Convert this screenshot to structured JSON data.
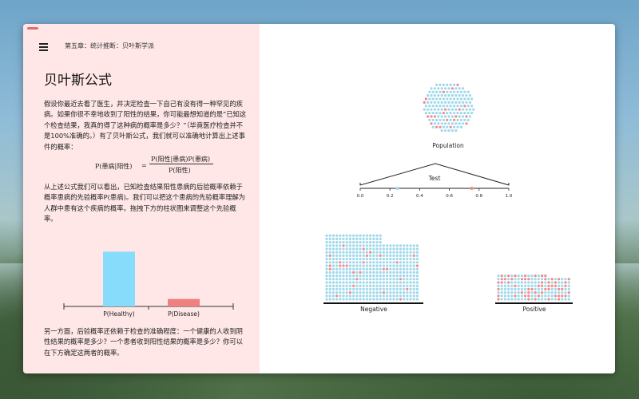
{
  "breadcrumb": "第五章：统计推断：贝叶斯学派",
  "page_title": "贝叶斯公式",
  "paragraphs": [
    "假设你最近去看了医生，并决定检查一下自己有没有得一种罕见的疾病。如果你很不幸地收到了阳性的结果，你可能最想知道的是“已知这个检查结果，我真的得了这种病的概率是多少？”（毕竟医疗检查并不是100%准确的。）有了贝叶斯公式，我们就可以准确地计算出上述事件的概率：",
    "从上述公式我们可以看出，已知检查结果阳性患病的后验概率依赖于概率患病的先验概率P(患病)。我们可以把这个患病的先验概率理解为人群中患有这个疾病的概率。拖拽下方的柱状图来调整这个先验概率。",
    "另一方面，后验概率还依赖于检查的准确程度：一个健康的人收到阴性结果的概率是多少？一个患者收到阳性结果的概率是多少？你可以在下方确定这两者的概率。"
  ],
  "formula": {
    "lhs": "P(患病|阳性)",
    "eq": "=",
    "numerator": "P(阳性|患病)P(患病)",
    "denominator": "P(阳性)"
  },
  "chart_data": {
    "type": "bar",
    "categories": [
      "P(Healthy)",
      "P(Disease)"
    ],
    "values": [
      0.88,
      0.12
    ],
    "colors": [
      "#87dcfb",
      "#f08080"
    ],
    "ylim": [
      0,
      1
    ]
  },
  "viz": {
    "population_label": "Population",
    "test_label": "Test",
    "scale_ticks": [
      "0.0",
      "0.2",
      "0.4",
      "0.6",
      "0.8",
      "1.0"
    ],
    "slider_markers": [
      0.25,
      0.75
    ],
    "negative_label": "Negative",
    "positive_label": "Positive",
    "healthy_color": "#9fd8ea",
    "disease_color": "#f08a8a"
  }
}
